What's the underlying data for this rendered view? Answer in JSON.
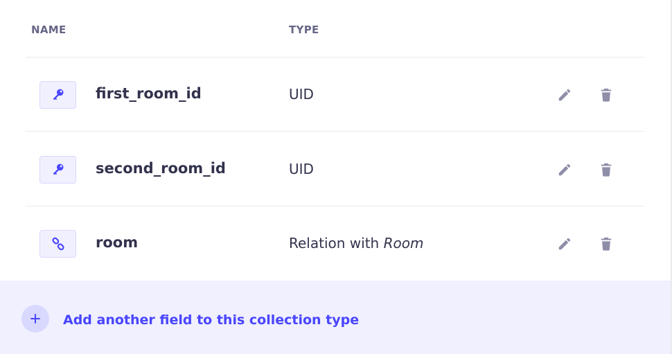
{
  "table": {
    "columns": {
      "name": "NAME",
      "type": "TYPE"
    },
    "rows": [
      {
        "icon": "key-icon",
        "name": "first_room_id",
        "type": "UID",
        "type_suffix": ""
      },
      {
        "icon": "key-icon",
        "name": "second_room_id",
        "type": "UID",
        "type_suffix": ""
      },
      {
        "icon": "link-icon",
        "name": "room",
        "type": "Relation with ",
        "type_suffix": "Room"
      }
    ]
  },
  "footer": {
    "add_label": "Add another field to this collection type"
  },
  "colors": {
    "accent": "#4945ff",
    "accent_bg": "#f0f0ff",
    "icon_gray": "#8e8ea9",
    "text": "#32324d",
    "header_text": "#666687"
  }
}
